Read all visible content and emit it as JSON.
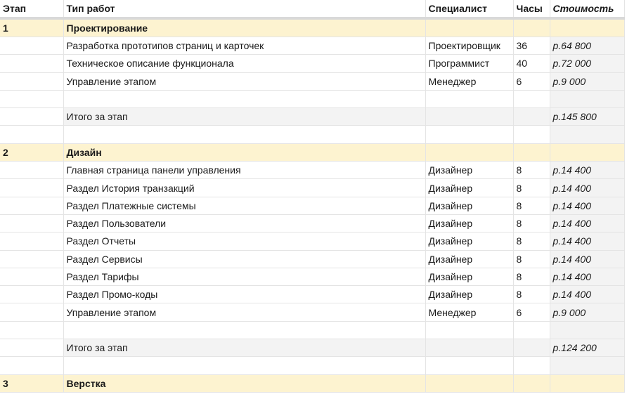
{
  "headers": {
    "stage": "Этап",
    "work": "Тип работ",
    "specialist": "Специалист",
    "hours": "Часы",
    "cost": "Стоимость"
  },
  "rows": [
    {
      "kind": "stage",
      "num": "1",
      "name": "Проектирование"
    },
    {
      "kind": "item",
      "name": "Разработка прототипов страниц и карточек",
      "spec": "Проектировщик",
      "hours": "36",
      "cost": "р.64 800"
    },
    {
      "kind": "item",
      "name": "Техническое описание функционала",
      "spec": "Программист",
      "hours": "40",
      "cost": "р.72 000"
    },
    {
      "kind": "item",
      "name": "Управление этапом",
      "spec": "Менеджер",
      "hours": "6",
      "cost": "р.9 000"
    },
    {
      "kind": "blank"
    },
    {
      "kind": "total",
      "name": "Итого за этап",
      "cost": "р.145 800"
    },
    {
      "kind": "blank"
    },
    {
      "kind": "stage",
      "num": "2",
      "name": "Дизайн"
    },
    {
      "kind": "item",
      "name": "Главная страница панели управления",
      "spec": "Дизайнер",
      "hours": "8",
      "cost": "р.14 400"
    },
    {
      "kind": "item",
      "name": "Раздел История транзакций",
      "spec": "Дизайнер",
      "hours": "8",
      "cost": "р.14 400"
    },
    {
      "kind": "item",
      "name": "Раздел Платежные системы",
      "spec": "Дизайнер",
      "hours": "8",
      "cost": "р.14 400"
    },
    {
      "kind": "item",
      "name": "Раздел Пользователи",
      "spec": "Дизайнер",
      "hours": "8",
      "cost": "р.14 400"
    },
    {
      "kind": "item",
      "name": "Раздел Отчеты",
      "spec": "Дизайнер",
      "hours": "8",
      "cost": "р.14 400"
    },
    {
      "kind": "item",
      "name": "Раздел Сервисы",
      "spec": "Дизайнер",
      "hours": "8",
      "cost": "р.14 400"
    },
    {
      "kind": "item",
      "name": "Раздел Тарифы",
      "spec": "Дизайнер",
      "hours": "8",
      "cost": "р.14 400"
    },
    {
      "kind": "item",
      "name": "Раздел Промо-коды",
      "spec": "Дизайнер",
      "hours": "8",
      "cost": "р.14 400"
    },
    {
      "kind": "item",
      "name": "Управление этапом",
      "spec": "Менеджер",
      "hours": "6",
      "cost": "р.9 000"
    },
    {
      "kind": "blank"
    },
    {
      "kind": "total",
      "name": "Итого за этап",
      "cost": "р.124 200"
    },
    {
      "kind": "blank"
    },
    {
      "kind": "stage",
      "num": "3",
      "name": "Верстка"
    }
  ]
}
